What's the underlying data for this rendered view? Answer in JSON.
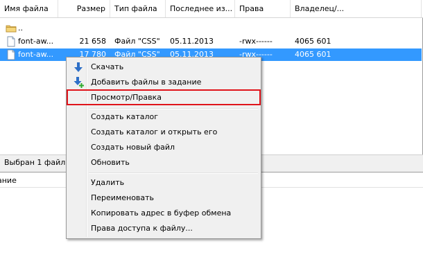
{
  "file_list": {
    "columns": [
      {
        "label": "Имя файла"
      },
      {
        "label": "Размер"
      },
      {
        "label": "Тип файла"
      },
      {
        "label": "Последнее из..."
      },
      {
        "label": "Права"
      },
      {
        "label": "Владелец/..."
      }
    ],
    "rows": [
      {
        "name": "..",
        "size": "",
        "type": "",
        "modified": "",
        "perms": "",
        "owner": "",
        "icon": "folder-icon",
        "selected": false
      },
      {
        "name": "font-aw...",
        "size": "21 658",
        "type": "Файл \"CSS\"",
        "modified": "05.11.2013",
        "perms": "-rwx------",
        "owner": "4065 601",
        "icon": "file-icon",
        "selected": false
      },
      {
        "name": "font-aw...",
        "size": "17 780",
        "type": "Файл \"CSS\"",
        "modified": "05.11.2013",
        "perms": "-rwx------",
        "owner": "4065 601",
        "icon": "file-icon",
        "selected": true
      }
    ]
  },
  "status_bar": {
    "text": "Выбран 1 файл. ..."
  },
  "queue": {
    "header": "ание"
  },
  "context_menu": {
    "items": [
      {
        "label": "Скачать",
        "icon": "download-arrow-icon"
      },
      {
        "label": "Добавить файлы в задание",
        "icon": "add-to-queue-icon"
      },
      {
        "label": "Просмотр/Правка",
        "highlighted": true
      },
      {
        "label": "Создать каталог"
      },
      {
        "label": "Создать каталог и открыть его"
      },
      {
        "label": "Создать новый файл"
      },
      {
        "label": "Обновить"
      },
      {
        "label": "Удалить"
      },
      {
        "label": "Переименовать"
      },
      {
        "label": "Копировать адрес в буфер обмена"
      },
      {
        "label": "Права доступа к файлу..."
      }
    ]
  },
  "colors": {
    "selection": "#3399ff",
    "highlight_border": "#e0131a",
    "download_arrow": "#2e6fc7",
    "add_plus": "#2faa2f"
  }
}
